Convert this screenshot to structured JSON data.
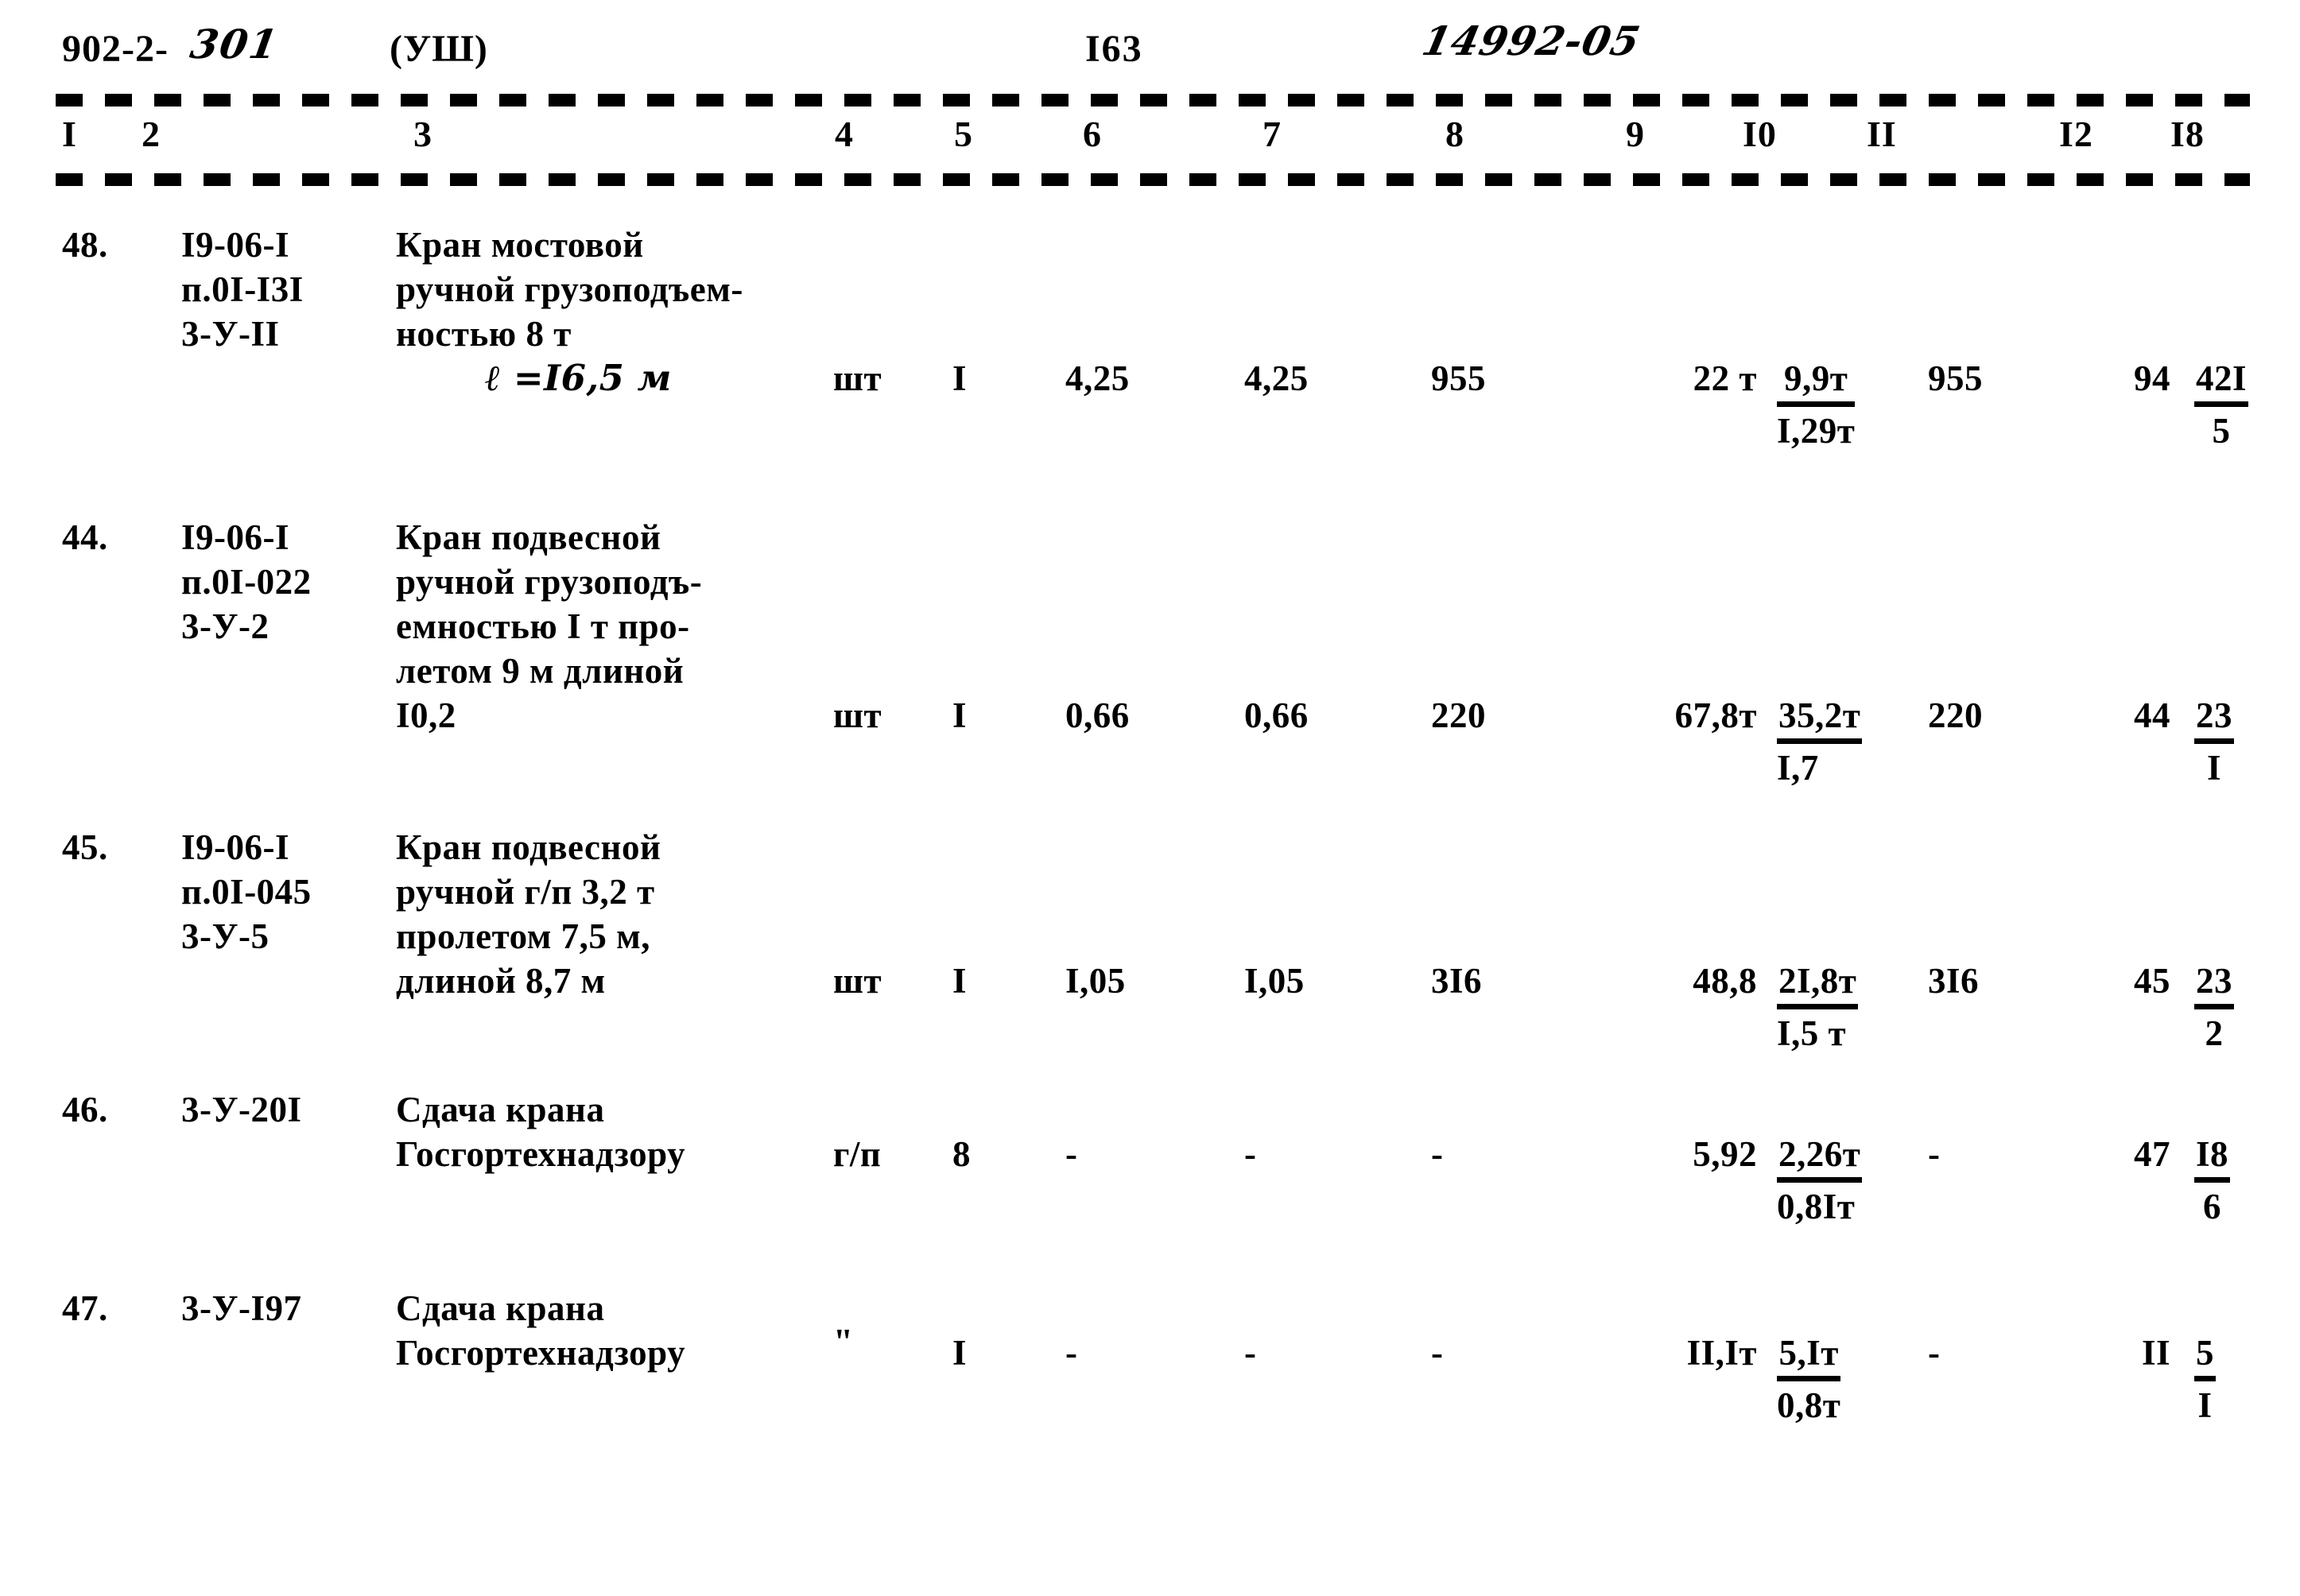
{
  "header": {
    "series_code": "902-2-",
    "handwritten_number": "301",
    "part": "(УШ)",
    "page_number": "I63",
    "handwritten_doc": "14992-05"
  },
  "table": {
    "column_headers": [
      "I",
      "2",
      "3",
      "4",
      "5",
      "6",
      "7",
      "8",
      "9",
      "I0",
      "II",
      "I2",
      "I8"
    ],
    "rows": [
      {
        "num": "48.",
        "code_lines": [
          "I9-06-I",
          "п.0I-I3I",
          "3-У-II"
        ],
        "desc_lines": [
          "Кран мостовой",
          "ручной грузоподъем-",
          "ностью 8 т",
          "ℓ =I6,5 м"
        ],
        "unit": "шт",
        "qty": "I",
        "c6": "4,25",
        "c7": "4,25",
        "c8": "955",
        "c9": "22 т",
        "c10_top": "9,9т",
        "c10_bot": "I,29т",
        "c11": "955",
        "c12": "94",
        "c13_top": "42I",
        "c13_bot": "5"
      },
      {
        "num": "44.",
        "code_lines": [
          "I9-06-I",
          "п.0I-022",
          "3-У-2"
        ],
        "desc_lines": [
          "Кран подвесной",
          "ручной грузоподъ-",
          "емностью I т про-",
          "летом 9 м длиной",
          "I0,2"
        ],
        "unit": "шт",
        "qty": "I",
        "c6": "0,66",
        "c7": "0,66",
        "c8": "220",
        "c9": "67,8т",
        "c10_top": "35,2т",
        "c10_bot": "I,7",
        "c11": "220",
        "c12": "44",
        "c13_top": "23",
        "c13_bot": "I"
      },
      {
        "num": "45.",
        "code_lines": [
          "I9-06-I",
          "п.0I-045",
          "3-У-5"
        ],
        "desc_lines": [
          "Кран подвесной",
          "ручной г/п 3,2 т",
          "пролетом 7,5 м,",
          "длиной 8,7 м"
        ],
        "unit": "шт",
        "qty": "I",
        "c6": "I,05",
        "c7": "I,05",
        "c8": "3I6",
        "c9": "48,8",
        "c10_top": "2I,8т",
        "c10_bot": "I,5 т",
        "c11": "3I6",
        "c12": "45",
        "c13_top": "23",
        "c13_bot": "2"
      },
      {
        "num": "46.",
        "code_lines": [
          "3-У-20I"
        ],
        "desc_lines": [
          "Сдача крана",
          "Госгортехнадзору"
        ],
        "unit": "г/п",
        "qty": "8",
        "c6": "-",
        "c7": "-",
        "c8": "-",
        "c9": "5,92",
        "c10_top": "2,26т",
        "c10_bot": "0,8Iт",
        "c11": "-",
        "c12": "47",
        "c13_top": "I8",
        "c13_bot": "6"
      },
      {
        "num": "47.",
        "code_lines": [
          "3-У-I97"
        ],
        "desc_lines": [
          "Сдача крана",
          "Госгортехнадзору"
        ],
        "unit": "\"",
        "qty": "I",
        "c6": "-",
        "c7": "-",
        "c8": "-",
        "c9": "II,Iт",
        "c10_top": "5,Iт",
        "c10_bot": "0,8т",
        "c11": "-",
        "c12": "II",
        "c13_top": "5",
        "c13_bot": "I"
      }
    ]
  }
}
